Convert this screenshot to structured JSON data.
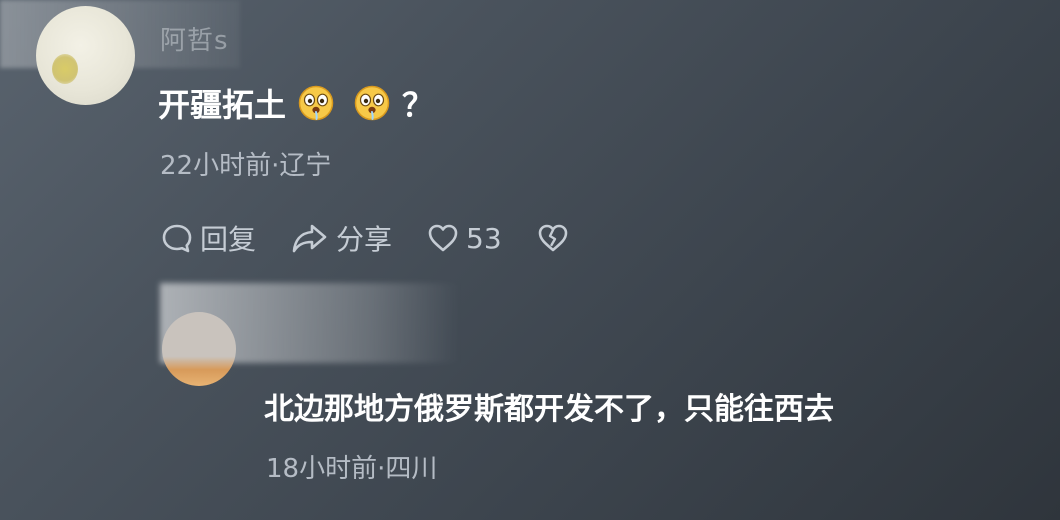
{
  "main_comment": {
    "username": "阿哲s",
    "text": "开疆拓土",
    "emoji_names": [
      "drooling-face-emoji",
      "drooling-face-emoji"
    ],
    "trailing": "？",
    "meta": "22小时前·辽宁",
    "actions": {
      "reply_label": "回复",
      "share_label": "分享",
      "like_count": "53"
    }
  },
  "reply": {
    "text": "北边那地方俄罗斯都开发不了，只能往西去",
    "meta": "18小时前·四川"
  },
  "colors": {
    "background_start": "#59636e",
    "background_end": "#2f353c",
    "primary_text": "#ffffff",
    "secondary_text": "#b5bcc5"
  }
}
